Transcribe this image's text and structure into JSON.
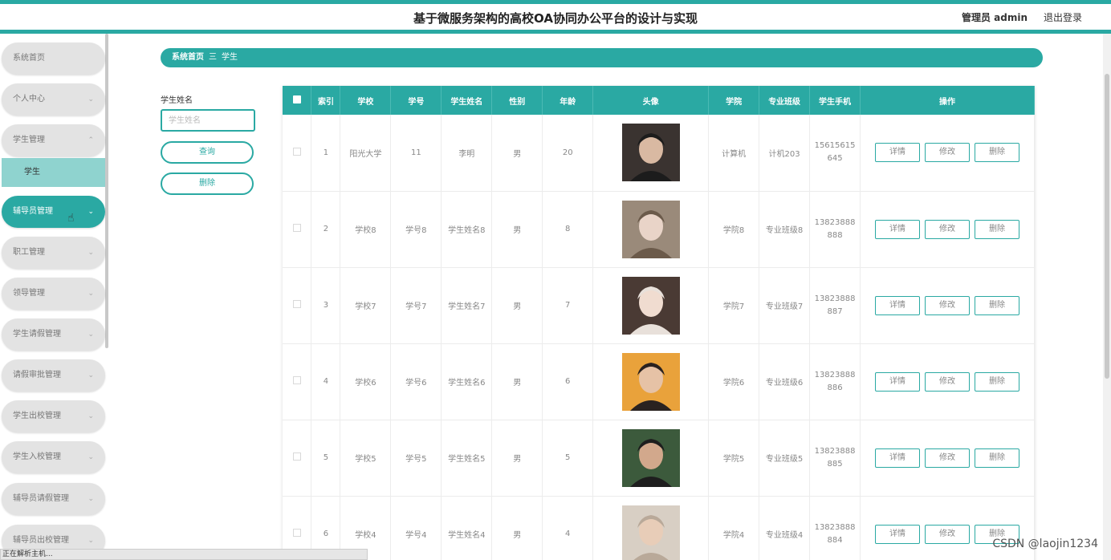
{
  "header": {
    "title": "基于微服务架构的高校OA协同办公平台的设计与实现",
    "admin": "管理员 admin",
    "logout": "退出登录"
  },
  "sidebar": {
    "items": [
      {
        "label": "系统首页",
        "has_chevron": false
      },
      {
        "label": "个人中心",
        "has_chevron": true
      },
      {
        "label": "学生管理",
        "has_chevron": true,
        "expanded": true
      },
      {
        "label": "辅导员管理",
        "has_chevron": true,
        "active": true
      },
      {
        "label": "职工管理",
        "has_chevron": true
      },
      {
        "label": "领导管理",
        "has_chevron": true
      },
      {
        "label": "学生请假管理",
        "has_chevron": true
      },
      {
        "label": "请假审批管理",
        "has_chevron": true
      },
      {
        "label": "学生出校管理",
        "has_chevron": true
      },
      {
        "label": "学生入校管理",
        "has_chevron": true
      },
      {
        "label": "辅导员请假管理",
        "has_chevron": true
      },
      {
        "label": "辅导员出校管理",
        "has_chevron": true
      }
    ],
    "submenu": "学生"
  },
  "breadcrumb": {
    "home": "系统首页",
    "separator": "三",
    "current": "学生"
  },
  "filter": {
    "label": "学生姓名",
    "placeholder": "学生姓名",
    "query_button": "查询",
    "delete_button": "删除"
  },
  "table": {
    "headers": [
      "索引",
      "学校",
      "学号",
      "学生姓名",
      "性别",
      "年龄",
      "头像",
      "学院",
      "专业班级",
      "学生手机",
      "操作"
    ],
    "rows": [
      {
        "index": "1",
        "school": "阳光大学",
        "student_no": "11",
        "name": "李明",
        "gender": "男",
        "age": "20",
        "avatar": "avatar-1",
        "college": "计算机",
        "class": "计机203",
        "phone_1": "15615615",
        "phone_2": "645"
      },
      {
        "index": "2",
        "school": "学校8",
        "student_no": "学号8",
        "name": "学生姓名8",
        "gender": "男",
        "age": "8",
        "avatar": "avatar-2",
        "college": "学院8",
        "class": "专业班级8",
        "phone_1": "13823888",
        "phone_2": "888"
      },
      {
        "index": "3",
        "school": "学校7",
        "student_no": "学号7",
        "name": "学生姓名7",
        "gender": "男",
        "age": "7",
        "avatar": "avatar-3",
        "college": "学院7",
        "class": "专业班级7",
        "phone_1": "13823888",
        "phone_2": "887"
      },
      {
        "index": "4",
        "school": "学校6",
        "student_no": "学号6",
        "name": "学生姓名6",
        "gender": "男",
        "age": "6",
        "avatar": "avatar-4",
        "college": "学院6",
        "class": "专业班级6",
        "phone_1": "13823888",
        "phone_2": "886"
      },
      {
        "index": "5",
        "school": "学校5",
        "student_no": "学号5",
        "name": "学生姓名5",
        "gender": "男",
        "age": "5",
        "avatar": "avatar-5",
        "college": "学院5",
        "class": "专业班级5",
        "phone_1": "13823888",
        "phone_2": "885"
      },
      {
        "index": "6",
        "school": "学校4",
        "student_no": "学号4",
        "name": "学生姓名4",
        "gender": "男",
        "age": "4",
        "avatar": "avatar-6",
        "college": "学院4",
        "class": "专业班级4",
        "phone_1": "13823888",
        "phone_2": "884"
      }
    ],
    "actions": {
      "detail": "详情",
      "edit": "修改",
      "delete": "删除"
    }
  },
  "status_bar": "正在解析主机...",
  "watermark": "CSDN @laojin1234",
  "colors": {
    "accent": "#2aa9a3",
    "submenu": "#8fd3cf",
    "menu_bg": "#e3e3e3"
  }
}
